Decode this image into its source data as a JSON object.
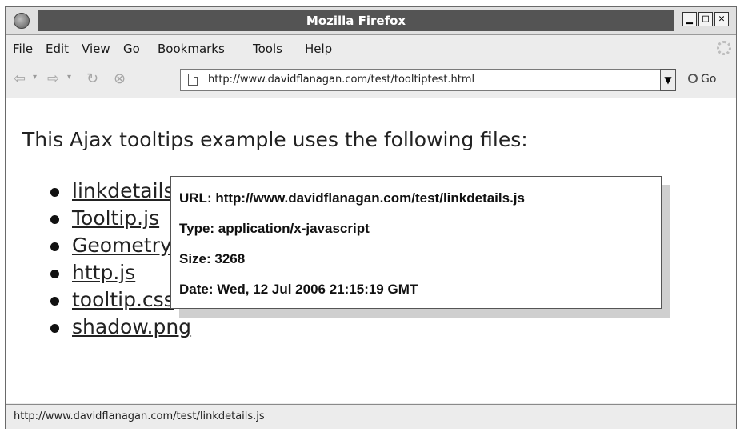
{
  "window": {
    "title": "Mozilla Firefox"
  },
  "window_controls": {
    "minimize": "▁",
    "maximize": "□",
    "close": "✕"
  },
  "menubar": {
    "items": [
      {
        "mnemonic": "F",
        "rest": "ile"
      },
      {
        "mnemonic": "E",
        "rest": "dit"
      },
      {
        "mnemonic": "V",
        "rest": "iew"
      },
      {
        "mnemonic": "G",
        "rest": "o"
      },
      {
        "mnemonic": "B",
        "rest": "ookmarks"
      },
      {
        "mnemonic": "T",
        "rest": "ools"
      },
      {
        "mnemonic": "H",
        "rest": "elp"
      }
    ]
  },
  "navbar": {
    "url": "http://www.davidflanagan.com/test/tooltiptest.html",
    "go_label": "Go",
    "icons": {
      "back": "back-arrow-icon",
      "forward": "forward-arrow-icon",
      "reload": "reload-icon",
      "stop": "stop-icon",
      "page": "page-icon",
      "go": "go-icon"
    }
  },
  "page": {
    "heading": "This Ajax tooltips example uses the following files:",
    "files": [
      "linkdetails.js",
      "Tooltip.js",
      "Geometry.js",
      "http.js",
      "tooltip.css",
      "shadow.png"
    ]
  },
  "tooltip": {
    "url_line": "URL: http://www.davidflanagan.com/test/linkdetails.js",
    "type_line": "Type: application/x-javascript",
    "size_line": "Size: 3268",
    "date_line": "Date: Wed, 12 Jul 2006 21:15:19 GMT"
  },
  "status": {
    "text": "http://www.davidflanagan.com/test/linkdetails.js"
  }
}
